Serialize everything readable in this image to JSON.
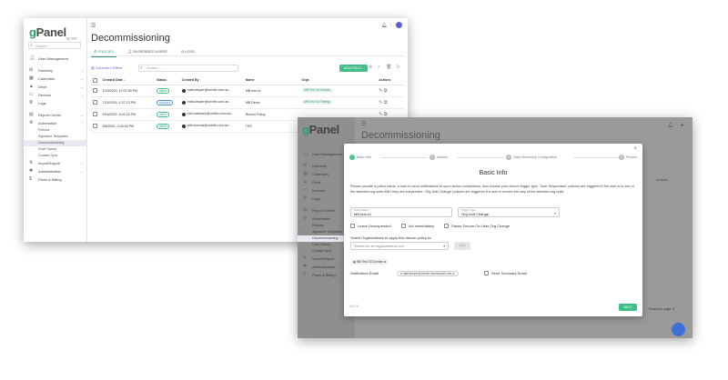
{
  "logo": {
    "brand_g": "g",
    "brand_rest": "Panel",
    "by": "by Onix"
  },
  "sidebar": {
    "search_placeholder": "Search",
    "items": [
      {
        "icon": "person-icon",
        "label": "User Management",
        "chev": ""
      },
      {
        "icon": "directory-icon",
        "label": "Directory",
        "chev": "⌄"
      },
      {
        "icon": "calendar-icon",
        "label": "Calendars",
        "chev": "⌄"
      },
      {
        "icon": "drive-icon",
        "label": "Drive",
        "chev": "⌄"
      },
      {
        "icon": "devices-icon",
        "label": "Devices",
        "chev": "⌄"
      },
      {
        "icon": "logs-icon",
        "label": "Logs",
        "chev": ""
      },
      {
        "icon": "report-icon",
        "label": "Report Center",
        "chev": "⌄"
      },
      {
        "icon": "automation-icon",
        "label": "Automation",
        "chev": "⌃"
      }
    ],
    "sub_items": [
      "Policies",
      "Signature Templates",
      "Decommissioning",
      "Drive Sweep",
      "Contact Sync"
    ],
    "items_after": [
      {
        "icon": "import-icon",
        "label": "Import/Export",
        "chev": "⌄"
      },
      {
        "icon": "admin-icon",
        "label": "Administration",
        "chev": "⌄"
      },
      {
        "icon": "plans-icon",
        "label": "Plans & Billing",
        "chev": ""
      }
    ]
  },
  "header": {
    "title": "Decommissioning",
    "menu_icon": "☰"
  },
  "tabs": [
    {
      "label": "POLICIES",
      "active": true
    },
    {
      "label": "SUSPENDED USERS",
      "active": false
    },
    {
      "label": "LOGS",
      "active": false
    }
  ],
  "toolbar": {
    "left": "▥ Columns  ≡ Filters",
    "search_placeholder": "Search…",
    "add_label": "ADD POLICY",
    "icons": "▸ ⊘ ✓ 🗑 ↻"
  },
  "table": {
    "headers": [
      "Created Date ↓",
      "Status",
      "Created By",
      "Name",
      "Orgs",
      "Actions"
    ],
    "rows": [
      {
        "date": "10/3/2024, 12:07:49 PM",
        "status": "active",
        "by": "matt.keuper@onixfix.com.au…",
        "name": "MB test #1",
        "org": "MB Test OU Domain"
      },
      {
        "date": "7/14/2024, 1:37:13 PM",
        "status": "disabled",
        "by": "matt.keuper@onixfix.com.au…",
        "name": "MB Demo",
        "org": "MB Test OU Testing"
      },
      {
        "date": "9/16/2022, 8:32:16 PM",
        "status": "active",
        "by": "info.marinack@onixfix.com.au…",
        "name": "Recent Policy",
        "org": ""
      },
      {
        "date": "5/6/2022, 4:25:53 PM",
        "status": "active",
        "by": "phil.morrow@onixfix.com.au…",
        "name": "TSS",
        "org": ""
      }
    ]
  },
  "modal": {
    "steps": [
      {
        "n": "1",
        "label": "Basic Info"
      },
      {
        "n": "2",
        "label": "Actions"
      },
      {
        "n": "3",
        "label": "Data Ownership Configuration"
      },
      {
        "n": "4",
        "label": "Review"
      }
    ],
    "title": "Basic Info",
    "description": "Please provide a policy name, a user to send notifications to upon action completions, and choose your decom trigger type. 'User Suspension' policies are triggered if the user is in one of the selected org units AND they are suspended. 'Org Unit Change' policies are triggered if a user is moved into any of the selected org units.",
    "policy_name_label": "Policy Name *",
    "policy_name_value": "MB test #1",
    "trigger_label": "Trigger Type",
    "trigger_value": "Org Unit Change",
    "checkboxes": [
      "Leave Unsuspended",
      "Act immediately",
      "Pause Decom On User Org Change"
    ],
    "select_label": "Select Organizations to apply this decom policy to:",
    "select_placeholder": "Search for an organizational unit",
    "add_label": "ADD",
    "chip": "MB Test OU Domain",
    "notif_label": "Notification Email",
    "email": "matt.keuper@onixfix.onmicrosoft.com",
    "summary_label": "Send Summary Email",
    "back_label": "BACK",
    "next_label": "NEXT"
  },
  "front_ghost": {
    "actions": "Actions",
    "rows_per_page": "Rows per page: 5"
  },
  "colors": {
    "accent": "#3fbf84",
    "brand": "#2e9e6b",
    "info": "#4d88d6"
  }
}
